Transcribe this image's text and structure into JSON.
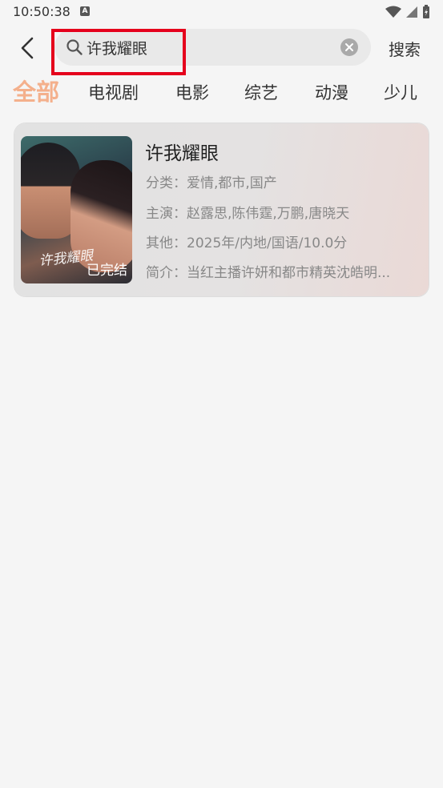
{
  "status_bar": {
    "time": "10:50:38",
    "notification_letter": "A"
  },
  "search": {
    "value": "许我耀眼",
    "button_label": "搜索"
  },
  "tabs": [
    "全部",
    "电视剧",
    "电影",
    "综艺",
    "动漫",
    "少儿"
  ],
  "active_tab": "全部",
  "result": {
    "title": "许我耀眼",
    "poster_title": "许我耀眼",
    "badge": "已完结",
    "category_label": "分类：",
    "category": "爱情,都市,国产",
    "cast_label": "主演：",
    "cast": "赵露思,陈伟霆,万鹏,唐晓天",
    "other_label": "其他：",
    "other": "2025年/内地/国语/10.0分",
    "intro_label": "简介：",
    "intro": "当红主播许妍和都市精英沈皓明..."
  },
  "colors": {
    "accent": "#f4b08c",
    "highlight": "#e5001c",
    "background": "#f5f5f5"
  }
}
